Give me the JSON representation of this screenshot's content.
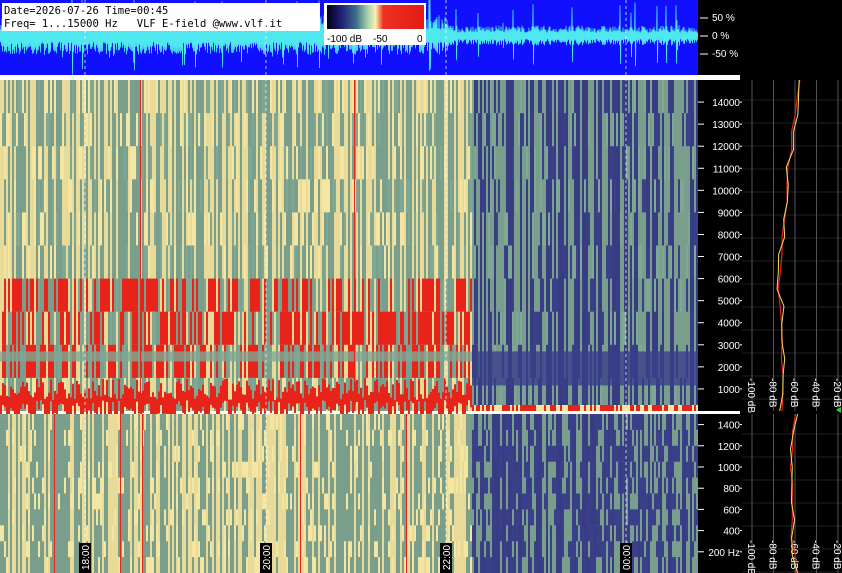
{
  "header": {
    "line1": "Date=2026-07-26 Time=00:45",
    "line2": "Freq= 1...15000 Hz   VLF E-field @www.vlf.it"
  },
  "colorbar": {
    "ticks": [
      "-100 dB",
      "-50",
      "0"
    ]
  },
  "waveform_scale": [
    "50 %",
    "0 %",
    "-50 %"
  ],
  "colors": {
    "waveform_bg": "#1010ff",
    "waveform_trace": "#4ee8ee",
    "spec_low": "#3a3f8a",
    "spec_mid": "#7fa894",
    "spec_hi": "#f4e6a0",
    "spec_peak": "#e8231a"
  },
  "chart_data": [
    {
      "type": "heatmap",
      "name": "upper-spectrogram",
      "ylabel": "",
      "ylim": [
        0,
        15000
      ],
      "yticks": [
        "1000",
        "2000",
        "3000",
        "4000",
        "5000",
        "6000",
        "7000",
        "8000",
        "9000",
        "10000",
        "11000",
        "12000",
        "13000",
        "14000"
      ],
      "x_time_labels": [
        "18:00",
        "20:00",
        "22:00",
        "00:00"
      ]
    },
    {
      "type": "heatmap",
      "name": "lower-spectrogram",
      "ylim": [
        0,
        1500
      ],
      "yticks": [
        "200 Hz",
        "400",
        "600",
        "800",
        "1000",
        "1200",
        "1400"
      ],
      "x_time_labels": [
        "18:00",
        "20:00",
        "22:00",
        "00:00"
      ]
    },
    {
      "type": "line",
      "name": "upper-spectrum-profile",
      "xticks": [
        "-100 dB",
        "-80 dB",
        "-60 dB",
        "-40 dB",
        "-20 dB"
      ],
      "series": [
        {
          "values": [
            -72,
            -71,
            -71,
            -72,
            -71,
            -73,
            -72,
            -74,
            -73,
            -73,
            -72,
            -70,
            -69,
            -68,
            -66,
            -64,
            -62,
            -60,
            -58,
            -56
          ]
        }
      ]
    },
    {
      "type": "line",
      "name": "lower-spectrum-profile",
      "xticks": [
        "-100 dB",
        "-80 dB",
        "-60 dB",
        "-40 dB",
        "-20 dB"
      ],
      "series": [
        {
          "values": [
            -60,
            -61,
            -62,
            -62,
            -63,
            -63,
            -64,
            -63,
            -62,
            -60
          ]
        }
      ]
    }
  ]
}
